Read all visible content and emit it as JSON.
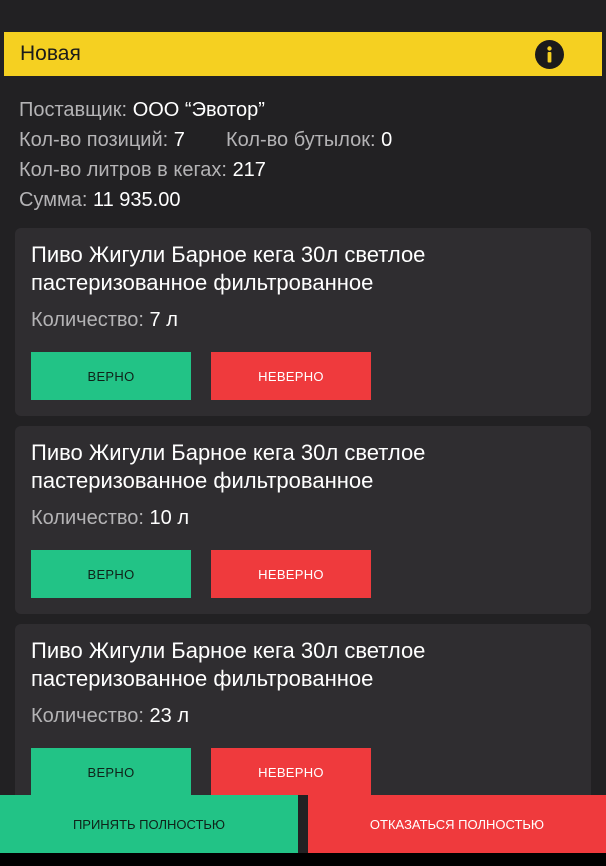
{
  "header": {
    "title": "Новая",
    "icon": "info-icon",
    "color": "#f5d021"
  },
  "summary": {
    "supplier_label": "Поставщик:",
    "supplier_value": "ООО “Эвотор”",
    "positions_label": "Кол-во позиций:",
    "positions_value": "7",
    "bottles_label": "Кол-во бутылок:",
    "bottles_value": "0",
    "liters_label": "Кол-во литров в кегах:",
    "liters_value": "217",
    "sum_label": "Сумма:",
    "sum_value": "11 935.00"
  },
  "items": [
    {
      "title_line1": "Пиво Жигули Барное кега 30л светлое",
      "title_line2": "пастеризованное фильтрованное",
      "qty_label": "Количество:",
      "qty_value": "7 л",
      "ok_label": "ВЕРНО",
      "bad_label": "НЕВЕРНО"
    },
    {
      "title_line1": "Пиво Жигули Барное кега 30л светлое",
      "title_line2": "пастеризованное фильтрованное",
      "qty_label": "Количество:",
      "qty_value": "10 л",
      "ok_label": "ВЕРНО",
      "bad_label": "НЕВЕРНО"
    },
    {
      "title_line1": "Пиво Жигули Барное кега 30л светлое",
      "title_line2": "пастеризованное фильтрованное",
      "qty_label": "Количество:",
      "qty_value": "23 л",
      "ok_label": "ВЕРНО",
      "bad_label": "НЕВЕРНО"
    }
  ],
  "footer": {
    "accept_all_label": "ПРИНЯТЬ ПОЛНОСТЬЮ",
    "reject_all_label": "ОТКАЗАТЬСЯ ПОЛНОСТЬЮ"
  },
  "colors": {
    "accept": "#22c386",
    "reject": "#ef3a3d",
    "background": "#222123",
    "card": "#2f2d30"
  }
}
